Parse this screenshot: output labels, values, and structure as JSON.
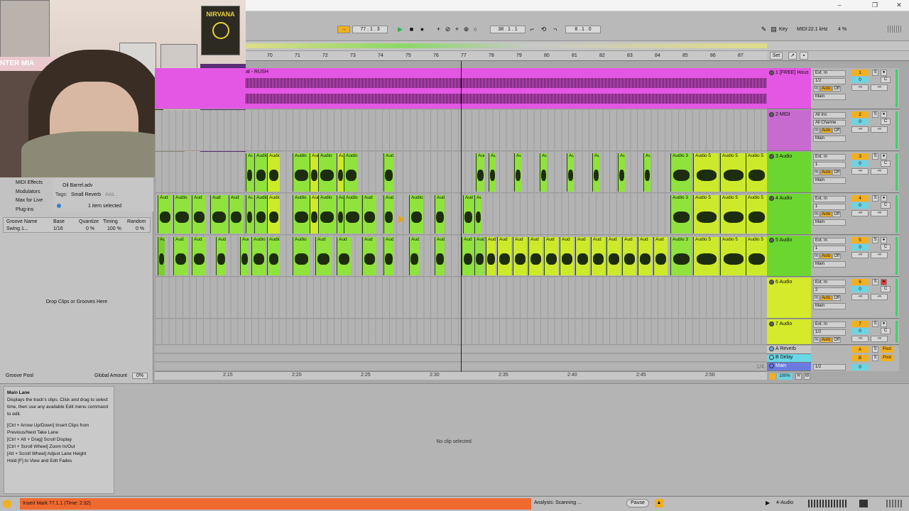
{
  "titlebar": {
    "min": "–",
    "max": "❐",
    "close": "✕"
  },
  "control": {
    "position": "77 .  1 .  3",
    "song_pos": "38 .  1 .  1",
    "loop_len": "8 .  1 .  0",
    "key_label": "Key",
    "midi_label": "MIDI",
    "sample_rate": "22.1 kHz",
    "cpu": "4 %"
  },
  "ruler": {
    "bars": [
      "70",
      "71",
      "72",
      "73",
      "74",
      "75",
      "76",
      "77",
      "78",
      "79",
      "80",
      "81",
      "82",
      "83",
      "84",
      "85",
      "86",
      "87"
    ],
    "times": [
      "2:15",
      "2:20",
      "2:25",
      "2:30",
      "2:35",
      "2:40",
      "2:45",
      "2:50"
    ],
    "set_label": "Set",
    "zoom_label": "1/4"
  },
  "tracks": [
    {
      "name": "1 [FREE] Hous",
      "clip_label": "at - RUSH",
      "color": "#e456e4",
      "input": "Ext. In",
      "sub": "1/2",
      "out": "Main",
      "num": "1",
      "vol": "0",
      "pan": "C",
      "send": "-∞"
    },
    {
      "name": "2 MIDI",
      "color": "#c76bd0",
      "input": "All Ins",
      "sub": "All Channe",
      "out": "Main",
      "num": "2",
      "vol": "0",
      "pan": "C",
      "send": "-∞"
    },
    {
      "name": "3 Audio",
      "color": "#6cd630",
      "input": "Ext. In",
      "sub": "1",
      "out": "Main",
      "num": "3",
      "vol": "0",
      "pan": "C",
      "send": "-∞"
    },
    {
      "name": "4 Audio",
      "color": "#6cd630",
      "input": "Ext. In",
      "sub": "1",
      "out": "Main",
      "num": "4",
      "vol": "0",
      "pan": "C",
      "send": "-∞"
    },
    {
      "name": "5 Audio",
      "color": "#6cd630",
      "input": "Ext. In",
      "sub": "1",
      "out": "Main",
      "num": "5",
      "vol": "0",
      "pan": "C",
      "send": "-∞"
    },
    {
      "name": "6 Audio",
      "color": "#d4ea2a",
      "input": "Ext. In",
      "sub": "2",
      "out": "Main",
      "num": "6",
      "vol": "0",
      "pan": "C",
      "send": "-∞"
    },
    {
      "name": "7 Audio",
      "color": "#d4ea2a",
      "input": "Ext. In",
      "sub": "1/2",
      "out": "Main",
      "num": "7",
      "vol": "0",
      "pan": "C",
      "send": "-∞"
    }
  ],
  "returns": [
    {
      "name": "A Reverb",
      "color": "#6ea8e6",
      "num": "A",
      "post": "Post"
    },
    {
      "name": "B Delay",
      "color": "#68d8e6",
      "num": "B",
      "post": "Post"
    },
    {
      "name": "Main",
      "color": "#6b7ae0",
      "sub": "1/2",
      "num": "0"
    }
  ],
  "clip_labels": {
    "audio": "Audio",
    "aud": "Aud",
    "audio3": "Audio 3",
    "audio5": "Audio 5"
  },
  "io_labels": {
    "in": "In",
    "auto": "Auto",
    "off": "Off"
  },
  "browser": {
    "items": [
      "MIDI Effects",
      "Modulators",
      "Max for Live",
      "Plug-ins"
    ],
    "file": "Oil Barrel.adv",
    "tags_label": "Tags:",
    "tag1": "Small Reverb",
    "tag_add": "Add...",
    "selected": "1 item selected",
    "groove_cols": [
      "Groove Name",
      "Base",
      "Quantize",
      "Timing",
      "Random"
    ],
    "groove_row": [
      "Swing 1...",
      "1/16",
      "0 %",
      "100 %",
      "0 %"
    ],
    "drop_text": "Drop Clips or Grooves Here",
    "groove_pool": "Groove Pool",
    "global_amount_label": "Global Amount",
    "global_amount": "0%"
  },
  "info": {
    "title": "Main Lane",
    "line1": "Displays the track's clips. Click and drag to select time, then use any available Edit menu command to edit.",
    "line2": "[Ctrl + Arrow Up/Down] Insert Clips from Previous/Next Take Lane",
    "line3": "[Ctrl + Alt + Drag] Scroll Display",
    "line4": "[Ctrl + Scroll Wheel] Zoom In/Out",
    "line5": "[Alt + Scroll Wheel] Adjust Lane Height",
    "line6": "Hold [F] to View and Edit Fades"
  },
  "detail": {
    "empty": "No clip selected."
  },
  "status": {
    "message": "Insert Mark 77.1.1 (Time: 2:32)",
    "analysis": "Analysis: Scanning ...",
    "pause": "Pause",
    "track": "4-Audio"
  },
  "zoom_pct": "100%",
  "cam": {
    "poster_text": "NIRVANA",
    "banner_text": "NTER MIA"
  }
}
